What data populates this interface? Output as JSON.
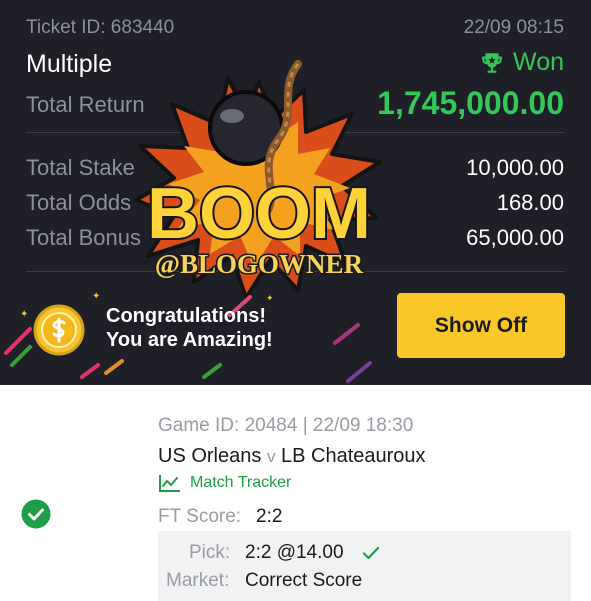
{
  "ticket": {
    "id_label": "Ticket ID: 683440",
    "datetime": "22/09 08:15",
    "type": "Multiple",
    "status": "Won",
    "status_icon": "trophy-icon",
    "total_return_label": "Total Return",
    "total_return_value": "1,745,000.00",
    "rows": [
      {
        "label": "Total Stake",
        "value": "10,000.00"
      },
      {
        "label": "Total Odds",
        "value": "168.00"
      },
      {
        "label": "Total Bonus",
        "value": "65,000.00"
      }
    ]
  },
  "overlay": {
    "boom_text": "BOOM",
    "watermark_text": "@BLOGOWNER"
  },
  "congrats": {
    "line1": "Congratulations!",
    "line2": "You are Amazing!",
    "coin_icon": "coin-icon",
    "button_label": "Show Off"
  },
  "selection": {
    "game_id": "Game ID: 20484 | 22/09 18:30",
    "home_team": "US Orleans",
    "vs": "v",
    "away_team": "LB Chateauroux",
    "tracker_label": "Match Tracker",
    "ft_score_label": "FT Score:",
    "ft_score_value": "2:2",
    "pick_label": "Pick:",
    "pick_value": "2:2 @14.00",
    "market_label": "Market:",
    "market_value": "Correct Score"
  },
  "colors": {
    "background_dark": "#1f2027",
    "accent_green": "#34c759",
    "button_yellow": "#f9c728"
  }
}
